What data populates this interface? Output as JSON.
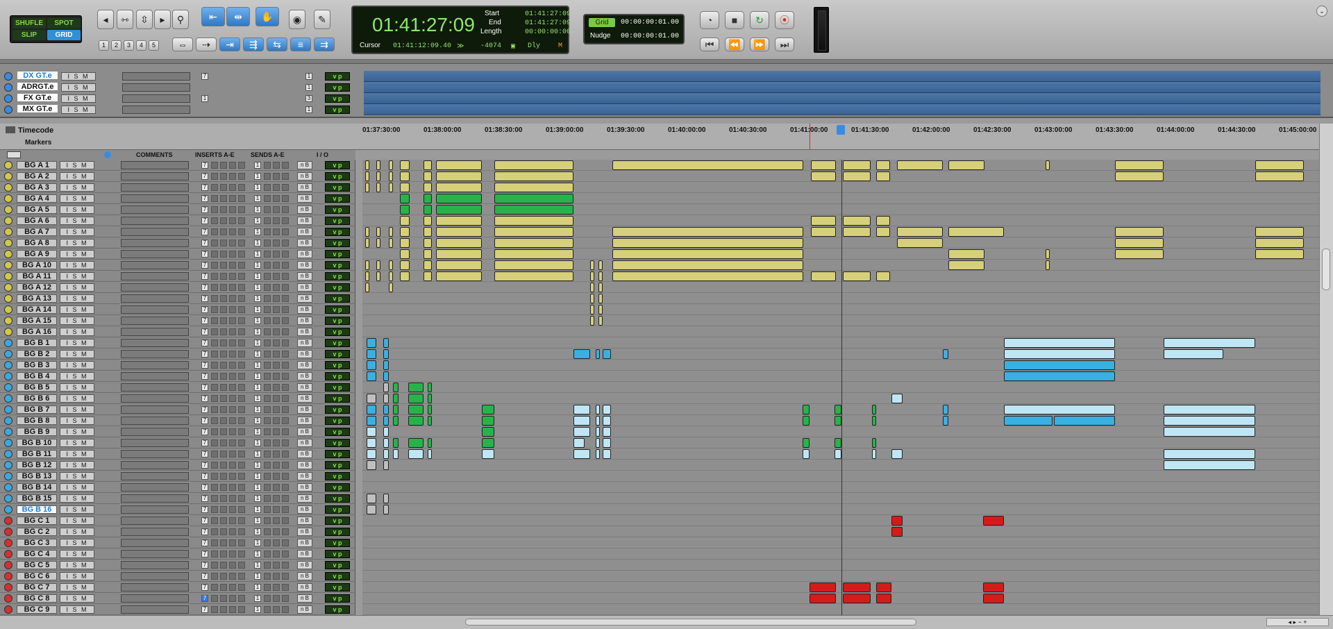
{
  "toolbar": {
    "modes": [
      "SHUFLE",
      "SPOT",
      "SLIP",
      "GRID"
    ],
    "zoom_presets": [
      "1",
      "2",
      "3",
      "4",
      "5"
    ],
    "counter": {
      "main_time": "01:41:27:09",
      "start_label": "Start",
      "start_value": "01:41:27:09",
      "end_label": "End",
      "end_value": "01:41:27:09",
      "length_label": "Length",
      "length_value": "00:00:00:00",
      "cursor_label": "Cursor",
      "cursor_value": "01:41:12:09.40",
      "offset_value": "-4074",
      "dly_label": "Dly",
      "m_label": "M"
    },
    "grid": {
      "grid_label": "Grid",
      "grid_value": "00:00:00:01.00",
      "nudge_label": "Nudge",
      "nudge_value": "00:00:00:01.00"
    }
  },
  "top_tracks": [
    {
      "name": "DX GT.e",
      "selected": true,
      "num": "7",
      "out": "1"
    },
    {
      "name": "ADRGT.e",
      "selected": false,
      "num": "",
      "out": "1"
    },
    {
      "name": "FX GT.e",
      "selected": false,
      "num": "1",
      "out": "3"
    },
    {
      "name": "MX GT.e",
      "selected": false,
      "num": "",
      "out": "1"
    }
  ],
  "rulers": {
    "timecode_label": "Timecode",
    "markers_label": "Markers",
    "ticks": [
      "01:37:30:00",
      "01:38:00:00",
      "01:38:30:00",
      "01:39:00:00",
      "01:39:30:00",
      "01:40:00:00",
      "01:40:30:00",
      "01:41:00:00",
      "01:41:30:00",
      "01:42:00:00",
      "01:42:30:00",
      "01:43:00:00",
      "01:43:30:00",
      "01:44:00:00",
      "01:44:30:00",
      "01:45:00:00"
    ]
  },
  "columns": {
    "comments": "COMMENTS",
    "inserts": "INSERTS A-E",
    "sends": "SENDS A-E",
    "io": "I / O"
  },
  "colors": {
    "yellow_clip": "#d7d07a",
    "green_clip": "#27b34a",
    "blue_clip": "#3bb0e0",
    "red_clip": "#d61a1a",
    "selection_blue": "#2f8fd8",
    "counter_green": "#8ee86a"
  },
  "tracks": [
    {
      "name": "BG A 1",
      "color": "yellow"
    },
    {
      "name": "BG A 2",
      "color": "yellow"
    },
    {
      "name": "BG A 3",
      "color": "yellow"
    },
    {
      "name": "BG A 4",
      "color": "yellow"
    },
    {
      "name": "BG A 5",
      "color": "yellow"
    },
    {
      "name": "BG A 6",
      "color": "yellow"
    },
    {
      "name": "BG A 7",
      "color": "yellow"
    },
    {
      "name": "BG A 8",
      "color": "yellow"
    },
    {
      "name": "BG A 9",
      "color": "yellow"
    },
    {
      "name": "BG A 10",
      "color": "yellow"
    },
    {
      "name": "BG A 11",
      "color": "yellow"
    },
    {
      "name": "BG A 12",
      "color": "yellow"
    },
    {
      "name": "BG A 13",
      "color": "yellow"
    },
    {
      "name": "BG A 14",
      "color": "yellow"
    },
    {
      "name": "BG A 15",
      "color": "yellow"
    },
    {
      "name": "BG A 16",
      "color": "yellow"
    },
    {
      "name": "BG B 1",
      "color": "blue"
    },
    {
      "name": "BG B 2",
      "color": "blue"
    },
    {
      "name": "BG B 3",
      "color": "blue"
    },
    {
      "name": "BG B 4",
      "color": "blue"
    },
    {
      "name": "BG B 5",
      "color": "blue"
    },
    {
      "name": "BG B 6",
      "color": "blue"
    },
    {
      "name": "BG B 7",
      "color": "blue"
    },
    {
      "name": "BG B 8",
      "color": "blue"
    },
    {
      "name": "BG B 9",
      "color": "blue"
    },
    {
      "name": "BG B 10",
      "color": "blue"
    },
    {
      "name": "BG B 11",
      "color": "blue"
    },
    {
      "name": "BG B 12",
      "color": "blue"
    },
    {
      "name": "BG B 13",
      "color": "blue"
    },
    {
      "name": "BG B 14",
      "color": "blue"
    },
    {
      "name": "BG B 15",
      "color": "blue"
    },
    {
      "name": "BG B 16",
      "color": "blue",
      "selected": true
    },
    {
      "name": "BG C 1",
      "color": "red"
    },
    {
      "name": "BG C 2",
      "color": "red"
    },
    {
      "name": "BG C 3",
      "color": "red"
    },
    {
      "name": "BG C 4",
      "color": "red"
    },
    {
      "name": "BG C 5",
      "color": "red"
    },
    {
      "name": "BG C 6",
      "color": "red"
    },
    {
      "name": "BG C 7",
      "color": "red"
    },
    {
      "name": "BG C 8",
      "color": "red"
    },
    {
      "name": "BG C 9",
      "color": "red"
    }
  ],
  "track_buttons": "I S M",
  "insert_value": "7",
  "send_value": "1",
  "io_value": "n B",
  "vp_value": "v p"
}
